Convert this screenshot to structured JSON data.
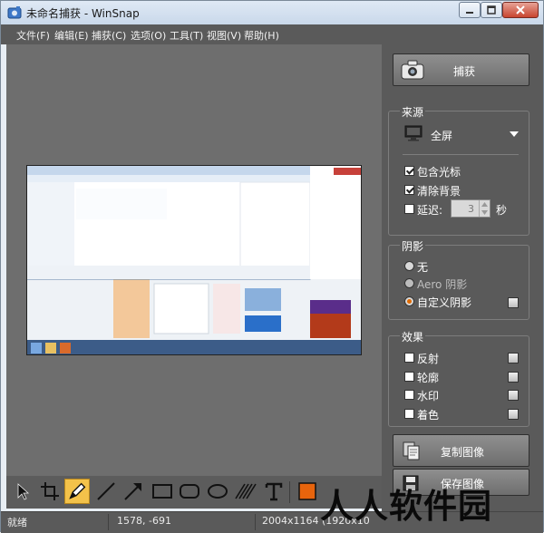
{
  "window": {
    "title": "未命名捕获 - WinSnap",
    "controls": [
      "minimize-icon",
      "maximize-icon",
      "close-icon"
    ]
  },
  "menu": {
    "items": [
      "文件(F)",
      "编辑(E)",
      "捕获(C)",
      "选项(O)",
      "工具(T)",
      "视图(V)",
      "帮助(H)"
    ]
  },
  "panel": {
    "capture_label": "捕获",
    "source": {
      "title": "来源",
      "mode": "全屏",
      "include_cursor": "包含光标",
      "clear_background": "清除背景",
      "delay_label": "延迟:",
      "delay_value": "3",
      "delay_unit": "秒",
      "include_cursor_checked": true,
      "clear_background_checked": true,
      "delay_checked": false
    },
    "shadow": {
      "title": "阴影",
      "none": "无",
      "aero": "Aero 阴影",
      "custom": "自定义阴影",
      "selected": "custom"
    },
    "effects": {
      "title": "效果",
      "items": [
        "反射",
        "轮廓",
        "水印",
        "着色"
      ]
    },
    "copy_image_label": "复制图像",
    "save_image_label": "保存图像"
  },
  "toolbar": {
    "tools": [
      "pointer-icon",
      "crop-icon",
      "pen-icon",
      "line-icon",
      "arrow-icon",
      "rectangle-icon",
      "rounded-rectangle-icon",
      "ellipse-icon",
      "hatch-icon",
      "text-icon",
      "color-swatch"
    ],
    "active_tool": "pen-icon",
    "accent_color": "#e8640c"
  },
  "status": {
    "state": "就绪",
    "cursor": "1578, -691",
    "size": "2004x1164 (1920x10"
  },
  "watermark": "人人软件园"
}
